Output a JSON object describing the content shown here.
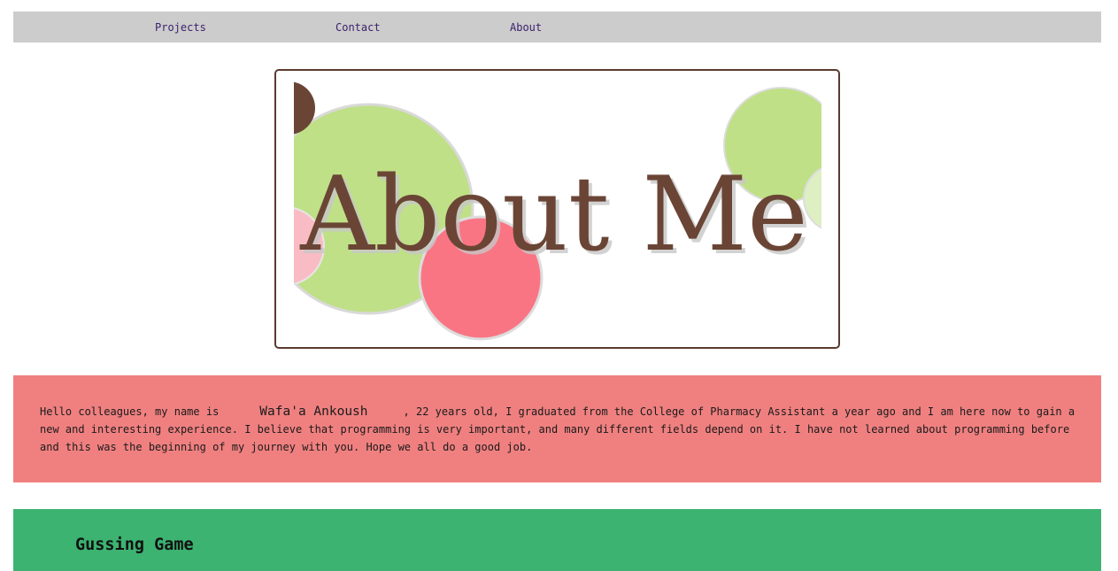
{
  "nav": {
    "items": [
      {
        "label": "Projects"
      },
      {
        "label": "Contact"
      },
      {
        "label": "About"
      }
    ]
  },
  "banner": {
    "heading": "About Me",
    "colors": {
      "text": "#6a4535",
      "green": "#bfe087",
      "pink": "#f9bcc4",
      "coral": "#fa7584",
      "brown": "#6a4535",
      "pale_green": "#deefc3"
    }
  },
  "intro": {
    "before": "Hello colleagues, my name is",
    "name": "Wafa'a Ankoush",
    "after": ", 22 years old, I graduated from the College of Pharmacy Assistant a year ago and I am here now to gain a new and interesting experience. I believe that programming is very important, and many different fields depend on it. I have not learned about programming before and this was the beginning of my journey with you. Hope we all do a good job."
  },
  "game": {
    "title": "Gussing Game"
  },
  "colors": {
    "nav_bg": "#cccccc",
    "nav_link": "#3b1f6b",
    "intro_bg": "#f08080",
    "game_bg": "#3cb371"
  }
}
